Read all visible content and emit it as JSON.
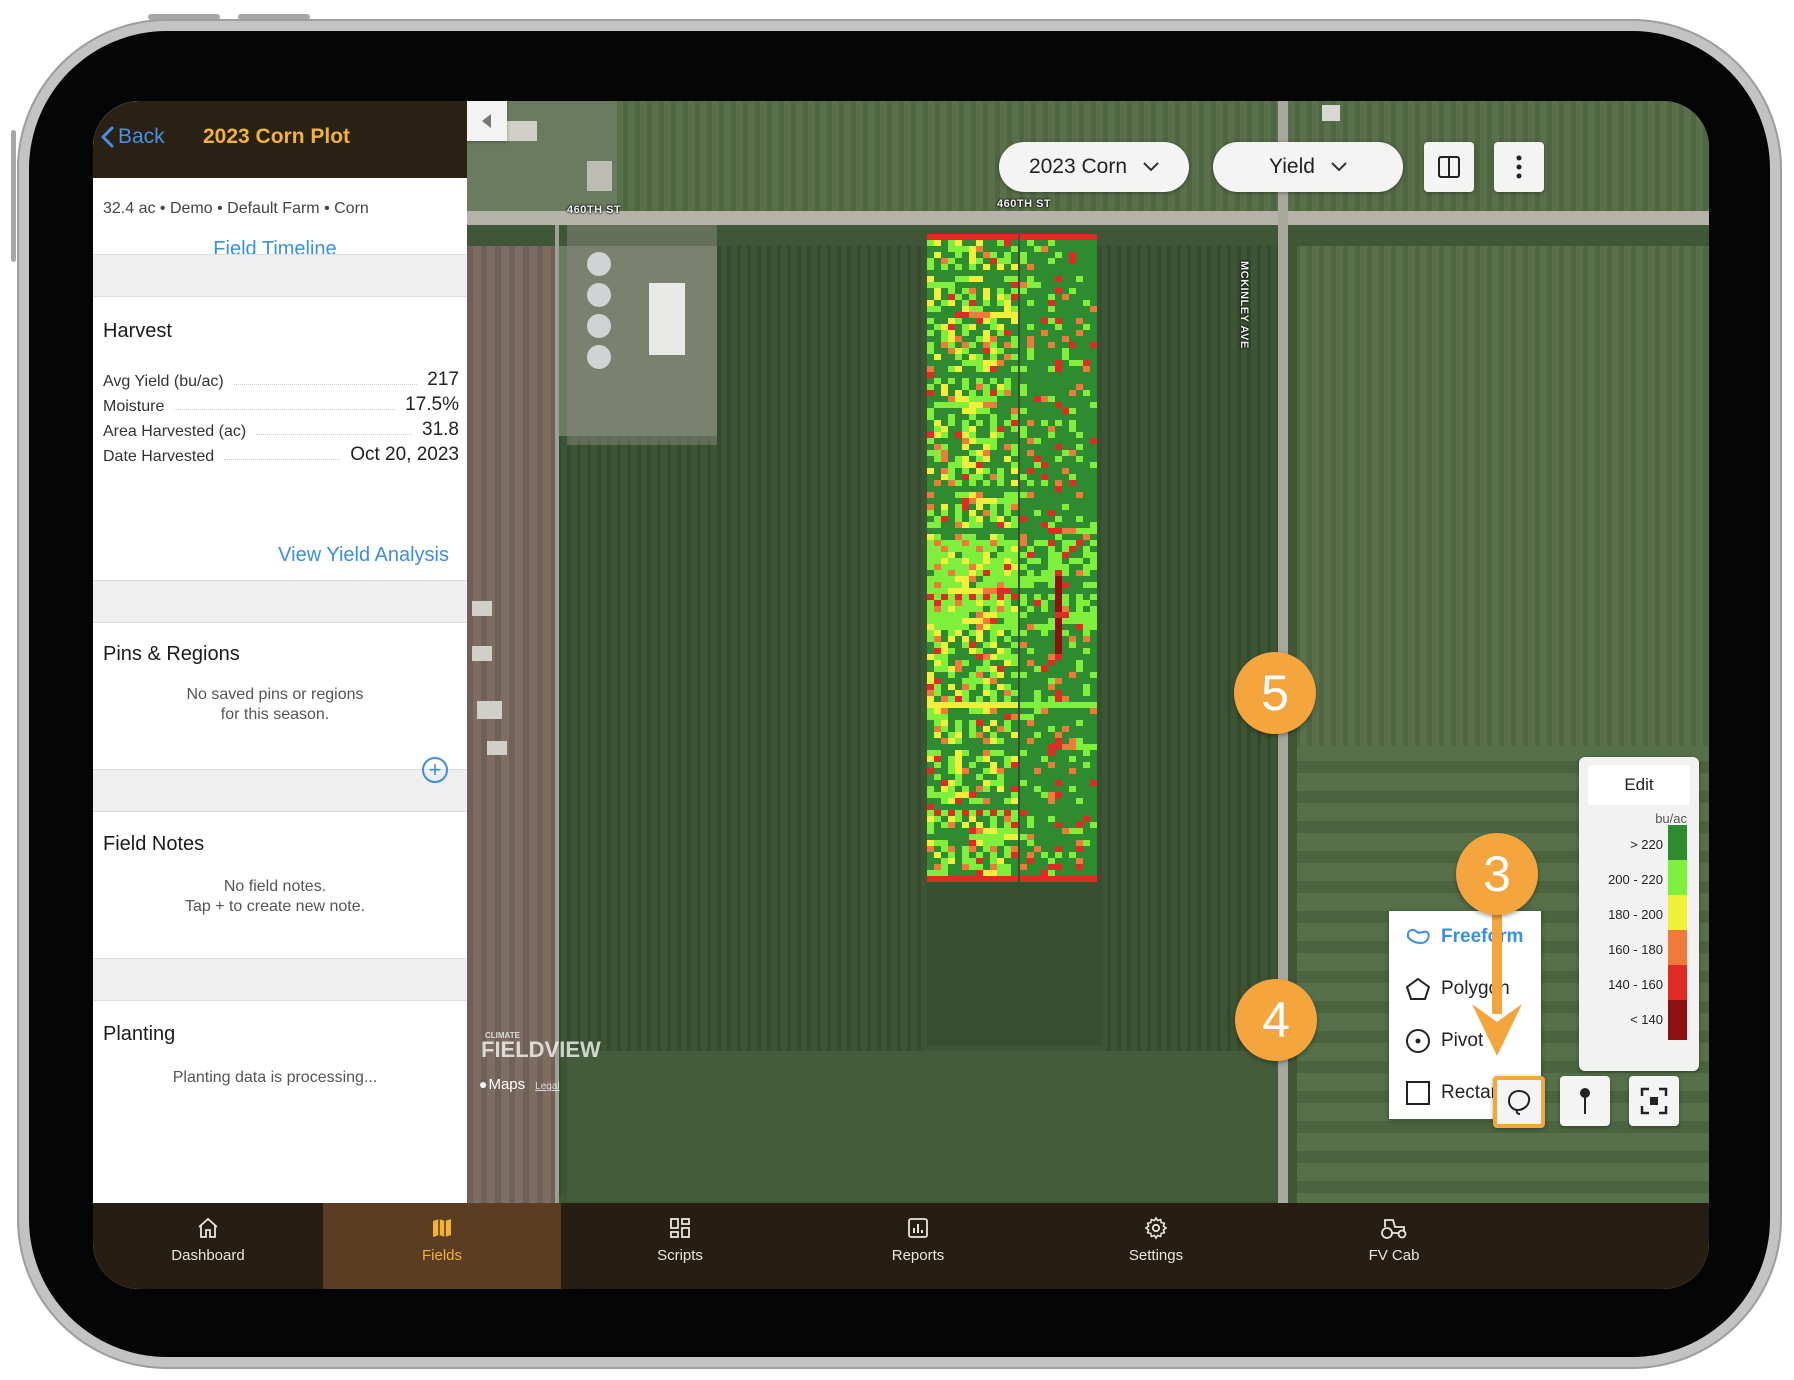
{
  "header": {
    "back_label": "Back",
    "title": "2023 Corn Plot"
  },
  "field_info": {
    "meta": "32.4 ac • Demo • Default Farm • Corn",
    "timeline_link": "Field Timeline"
  },
  "harvest": {
    "title": "Harvest",
    "rows": [
      {
        "label": "Avg Yield (bu/ac)",
        "value": "217"
      },
      {
        "label": "Moisture",
        "value": "17.5%"
      },
      {
        "label": "Area Harvested (ac)",
        "value": "31.8"
      },
      {
        "label": "Date Harvested",
        "value": "Oct 20, 2023"
      }
    ],
    "link": "View Yield Analysis"
  },
  "pins": {
    "title": "Pins & Regions",
    "empty_line1": "No saved pins or regions",
    "empty_line2": "for this season."
  },
  "notes": {
    "title": "Field Notes",
    "add_icon": "plus-circle-icon",
    "empty_line1": "No field notes.",
    "empty_line2": "Tap + to create new note."
  },
  "planting": {
    "title": "Planting",
    "status": "Planting data is processing..."
  },
  "map": {
    "season_select": "2023 Corn",
    "layer_select": "Yield",
    "street_labels": [
      "460TH ST",
      "460TH ST",
      "MCKINLEY AVE"
    ],
    "watermark_top": "CLIMATE",
    "watermark_brand": "FIELDVIEW",
    "maps_label": "Maps",
    "legal_label": "Legal",
    "legend": {
      "edit_label": "Edit",
      "unit": "bu/ac",
      "ranges": [
        {
          "label": "> 220",
          "color": "#2e8b2f"
        },
        {
          "label": "200 - 220",
          "color": "#7ef03c"
        },
        {
          "label": "180 - 200",
          "color": "#f0f03a"
        },
        {
          "label": "160 - 180",
          "color": "#f07a3a"
        },
        {
          "label": "140 - 160",
          "color": "#e02a24"
        },
        {
          "label": "< 140",
          "color": "#8e1010"
        }
      ]
    },
    "draw_menu": [
      {
        "label": "Freeform",
        "icon": "freeform-icon",
        "active": true
      },
      {
        "label": "Polygon",
        "icon": "polygon-icon"
      },
      {
        "label": "Pivot",
        "icon": "pivot-icon"
      },
      {
        "label": "Rectangle",
        "icon": "rectangle-icon"
      }
    ],
    "badges": [
      "3",
      "4",
      "5"
    ],
    "colors": {
      "accent": "#f4a53d",
      "link": "#3a8ee6",
      "header_bg": "#2a2115",
      "title": "#f2b23a"
    }
  },
  "tabs": [
    {
      "label": "Dashboard",
      "icon": "home-icon"
    },
    {
      "label": "Fields",
      "icon": "map-icon",
      "active": true
    },
    {
      "label": "Scripts",
      "icon": "grid-icon"
    },
    {
      "label": "Reports",
      "icon": "chart-icon"
    },
    {
      "label": "Settings",
      "icon": "gear-icon"
    },
    {
      "label": "FV Cab",
      "icon": "tractor-icon"
    }
  ]
}
